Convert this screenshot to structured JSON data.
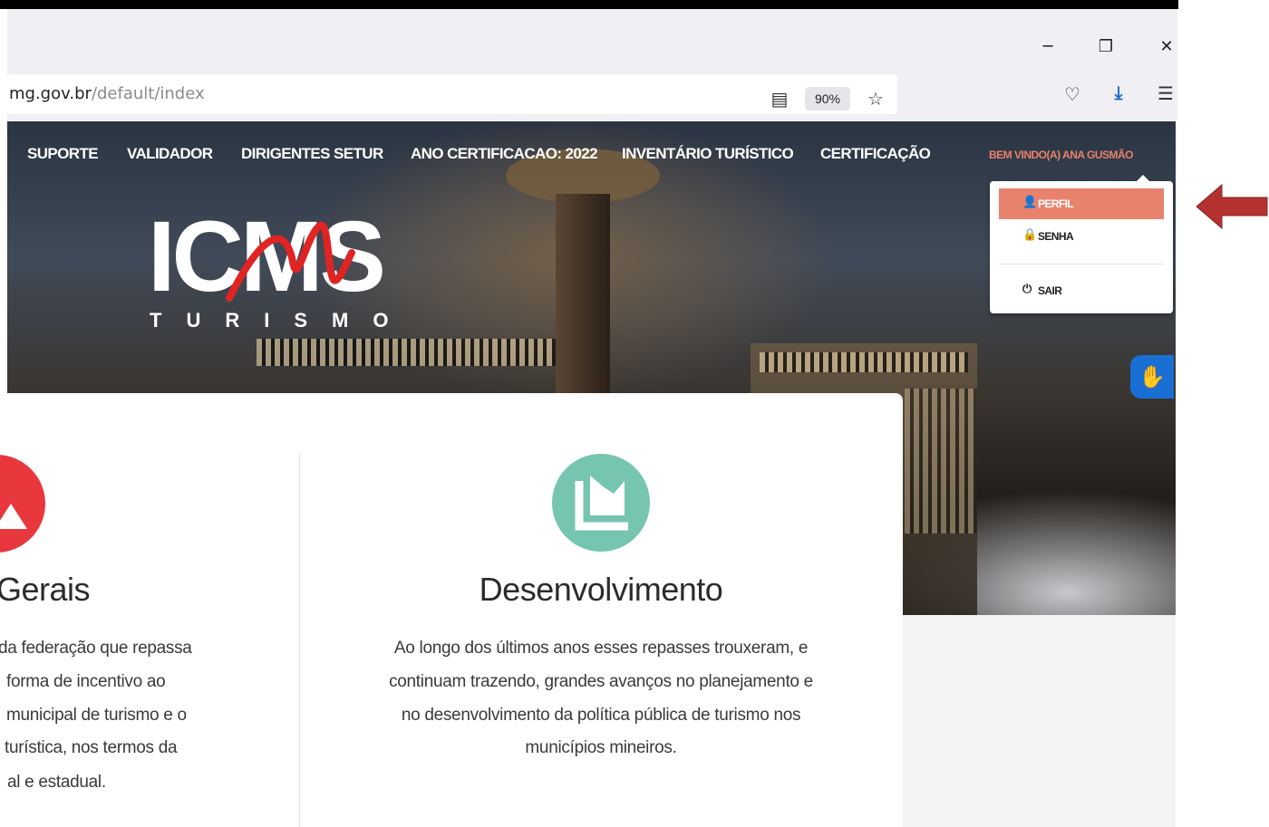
{
  "browser": {
    "url_host": "mg.gov.br",
    "url_path": "/default/index",
    "zoom": "90%",
    "window_controls": [
      "minimize-icon",
      "restore-icon",
      "close-icon"
    ],
    "toolbar_icons": [
      "reader-view-icon",
      "bookmark-star-icon",
      "pocket-icon",
      "download-icon",
      "menu-icon"
    ]
  },
  "nav": {
    "items": [
      "SUPORTE",
      "VALIDADOR",
      "DIRIGENTES SETUR",
      "ANO CERTIFICACAO: 2022",
      "INVENTÁRIO TURÍSTICO",
      "CERTIFICAÇÃO"
    ],
    "welcome": "BEM VINDO(A) ANA GUSMÃO"
  },
  "logo": {
    "word": "ICMS",
    "sub": "TURISMO"
  },
  "dropdown": {
    "items": [
      {
        "label": "PERFIL",
        "icon": "user-icon"
      },
      {
        "label": "SENHA",
        "icon": "lock-icon"
      },
      {
        "label": "SAIR",
        "icon": "power-icon"
      }
    ]
  },
  "accessibility": {
    "icon": "vlibras-hands-icon"
  },
  "annotation": {
    "icon": "red-arrow-left-icon",
    "color": "#b3312f"
  },
  "colors": {
    "accent": "#e8826c",
    "red": "#e8373d",
    "green": "#76c5b0"
  },
  "content": {
    "left": {
      "title": "Gerais",
      "lines": [
        "da federação que repassa",
        "forma de incentivo ao",
        "municipal de turismo e o",
        "turística, nos termos da",
        "al e estadual."
      ]
    },
    "right": {
      "title": "Desenvolvimento",
      "lines": [
        "Ao longo dos últimos anos esses repasses trouxeram, e",
        "continuam trazendo, grandes avanços no planejamento e",
        "no desenvolvimento da política pública de turismo nos",
        "municípios mineiros."
      ]
    }
  }
}
